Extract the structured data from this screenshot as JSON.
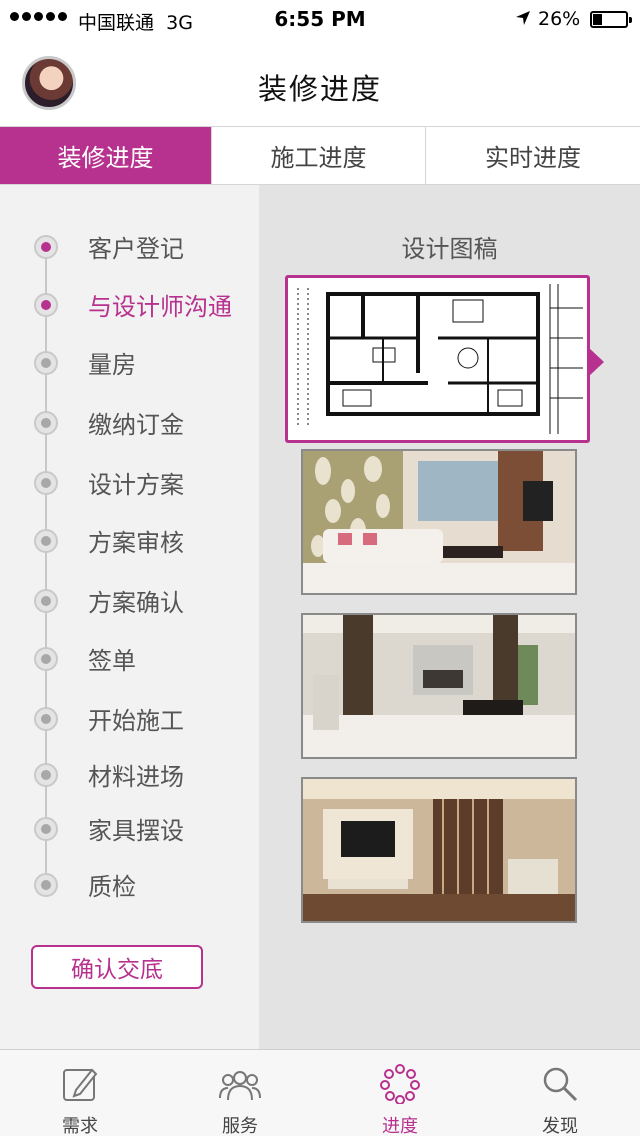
{
  "status_bar": {
    "carrier": "中国联通",
    "network": "3G",
    "time": "6:55 PM",
    "battery": "26%",
    "battery_level": 0.26
  },
  "header": {
    "title": "装修进度"
  },
  "tabs": [
    {
      "label": "装修进度",
      "active": true
    },
    {
      "label": "施工进度",
      "active": false
    },
    {
      "label": "实时进度",
      "active": false
    }
  ],
  "steps": [
    {
      "label": "客户登记",
      "state": "done"
    },
    {
      "label": "与设计师沟通",
      "state": "current"
    },
    {
      "label": "量房",
      "state": "pending"
    },
    {
      "label": "缴纳订金",
      "state": "pending"
    },
    {
      "label": "设计方案",
      "state": "pending"
    },
    {
      "label": "方案审核",
      "state": "pending"
    },
    {
      "label": "方案确认",
      "state": "pending"
    },
    {
      "label": "签单",
      "state": "pending"
    },
    {
      "label": "开始施工",
      "state": "pending"
    },
    {
      "label": "材料进场",
      "state": "pending"
    },
    {
      "label": "家具摆设",
      "state": "pending"
    },
    {
      "label": "质检",
      "state": "pending"
    }
  ],
  "confirm_button": "确认交底",
  "gallery": {
    "title": "设计图稿",
    "images": [
      "floor-plan",
      "living-room-render",
      "open-plan-render",
      "tv-wall-render"
    ]
  },
  "tabbar": [
    {
      "label": "需求",
      "icon": "edit-icon",
      "active": false
    },
    {
      "label": "服务",
      "icon": "people-icon",
      "active": false
    },
    {
      "label": "进度",
      "icon": "progress-ring-icon",
      "active": true
    },
    {
      "label": "发现",
      "icon": "search-icon",
      "active": false
    }
  ],
  "colors": {
    "accent": "#b7318f",
    "left_panel": "#f2f2f2",
    "right_panel": "#e3e3e3"
  }
}
